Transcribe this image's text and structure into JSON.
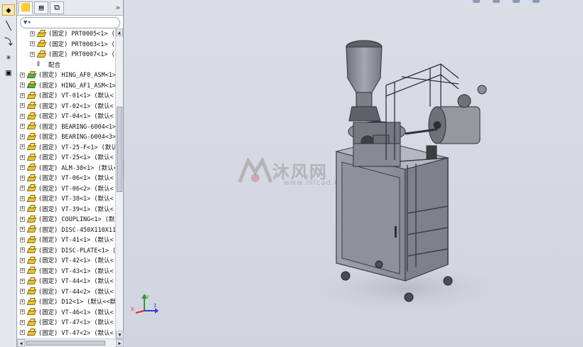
{
  "tabs": [
    {
      "icon": "feature-tree-icon"
    },
    {
      "icon": "property-manager-icon"
    },
    {
      "icon": "configuration-manager-icon"
    }
  ],
  "tree": {
    "items": [
      {
        "type": "part",
        "label": "(固定) PRT0005<1> (",
        "indent": 2
      },
      {
        "type": "part",
        "label": "(固定) PRT0003<1> (",
        "indent": 2
      },
      {
        "type": "part",
        "label": "(固定) PRT0007<1> (",
        "indent": 2
      },
      {
        "type": "mate",
        "label": "配合",
        "indent": 2
      },
      {
        "type": "asm",
        "label": "(固定) HING_AF0_ASM<1>",
        "indent": 0
      },
      {
        "type": "asm",
        "label": "(固定) HING_AF1_ASM<1>",
        "indent": 0
      },
      {
        "type": "part",
        "label": "(固定) VT-01<1> (默认<",
        "indent": 0
      },
      {
        "type": "part",
        "label": "(固定) VT-02<1> (默认<",
        "indent": 0
      },
      {
        "type": "part",
        "label": "(固定) VT-04<1> (默认<",
        "indent": 0
      },
      {
        "type": "part",
        "label": "(固定) BEARING-6004<1>",
        "indent": 0
      },
      {
        "type": "part",
        "label": "(固定) BEARING-6004<3>",
        "indent": 0
      },
      {
        "type": "part",
        "label": "(固定) VT-25-F<1> (默认",
        "indent": 0
      },
      {
        "type": "part",
        "label": "(固定) VT-25<1> (默认<",
        "indent": 0
      },
      {
        "type": "part",
        "label": "(固定) ALM-30<1> (默认<",
        "indent": 0
      },
      {
        "type": "part",
        "label": "(固定) VT-06<1> (默认<",
        "indent": 0
      },
      {
        "type": "part",
        "label": "(固定) VT-06<2> (默认<",
        "indent": 0
      },
      {
        "type": "part",
        "label": "(固定) VT-38<1> (默认<",
        "indent": 0
      },
      {
        "type": "part",
        "label": "(固定) VT-39<1> (默认<",
        "indent": 0
      },
      {
        "type": "part",
        "label": "(固定) COUPLING<1> (默",
        "indent": 0
      },
      {
        "type": "part",
        "label": "(固定) DISC-450X110X11",
        "indent": 0
      },
      {
        "type": "part",
        "label": "(固定) VT-41<1> (默认<",
        "indent": 0
      },
      {
        "type": "part",
        "label": "(固定) DISC-PLATE<1> (",
        "indent": 0
      },
      {
        "type": "part",
        "label": "(固定) VT-42<1> (默认<",
        "indent": 0
      },
      {
        "type": "part",
        "label": "(固定) VT-43<1> (默认<",
        "indent": 0
      },
      {
        "type": "part",
        "label": "(固定) VT-44<1> (默认<",
        "indent": 0
      },
      {
        "type": "part",
        "label": "(固定) VT-44<2> (默认<",
        "indent": 0
      },
      {
        "type": "part",
        "label": "(固定) D12<1> (默认<<默",
        "indent": 0
      },
      {
        "type": "part",
        "label": "(固定) VT-46<1> (默认<",
        "indent": 0
      },
      {
        "type": "part",
        "label": "(固定) VT-47<1> (默认<",
        "indent": 0
      },
      {
        "type": "part",
        "label": "(固定) VT-47<2> (默认<",
        "indent": 0
      }
    ]
  },
  "watermark": {
    "main": "沐风网",
    "sub": "www.mfcad.com"
  },
  "triad": {
    "x": "X",
    "y": "Y",
    "z": "Z"
  }
}
